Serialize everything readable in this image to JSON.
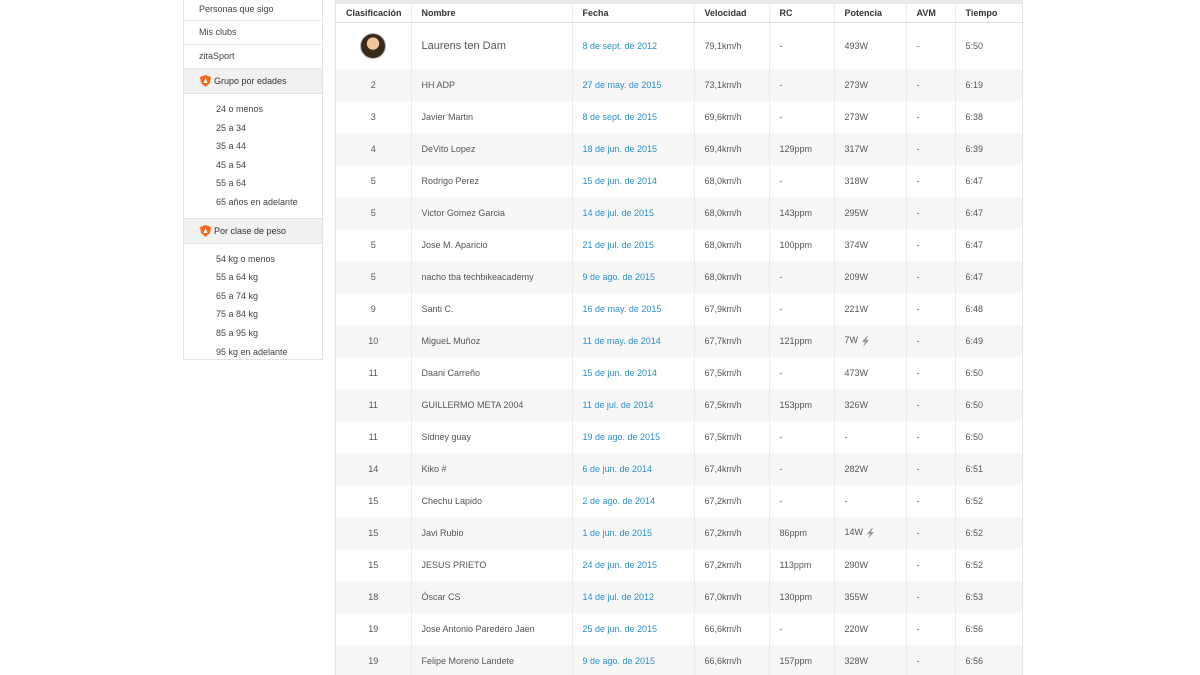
{
  "sidebar": {
    "links": [
      "Personas que sigo",
      "Mis clubs",
      "zitaSport"
    ],
    "age_group": {
      "title": "Grupo por edades",
      "items": [
        "24 o menos",
        "25 a 34",
        "35 a 44",
        "45 a 54",
        "55 a 64",
        "65 años en adelante"
      ]
    },
    "weight_group": {
      "title": "Por clase de peso",
      "items": [
        "54 kg o menos",
        "55 a 64 kg",
        "65 a 74 kg",
        "75 a 84 kg",
        "85 a 95 kg",
        "95 kg en adelante"
      ]
    }
  },
  "table": {
    "headers": [
      "Clasificación",
      "Nombre",
      "Fecha",
      "Velocidad",
      "RC",
      "Potencia",
      "AVM",
      "Tiempo"
    ],
    "first_row": {
      "name": "Laurens ten Dam",
      "date": "8 de sept. de 2012",
      "speed": "79,1km/h",
      "hr": "-",
      "power": "493W",
      "vam": "-",
      "time": "5:50"
    },
    "rows": [
      {
        "rank": "2",
        "name": "HH ADP",
        "date": "27 de may. de 2015",
        "speed": "73,1km/h",
        "hr": "-",
        "power": "273W",
        "vam": "-",
        "time": "6:19"
      },
      {
        "rank": "3",
        "name": "Javier Martin",
        "date": "8 de sept. de 2015",
        "speed": "69,6km/h",
        "hr": "-",
        "power": "273W",
        "vam": "-",
        "time": "6:38"
      },
      {
        "rank": "4",
        "name": "DeVito Lopez",
        "date": "18 de jun. de 2015",
        "speed": "69,4km/h",
        "hr": "129ppm",
        "power": "317W",
        "vam": "-",
        "time": "6:39"
      },
      {
        "rank": "5",
        "name": "Rodrigo Perez",
        "date": "15 de jun. de 2014",
        "speed": "68,0km/h",
        "hr": "-",
        "power": "318W",
        "vam": "-",
        "time": "6:47"
      },
      {
        "rank": "5",
        "name": "Victor Gomez Garcia",
        "date": "14 de jul. de 2015",
        "speed": "68,0km/h",
        "hr": "143ppm",
        "power": "295W",
        "vam": "-",
        "time": "6:47"
      },
      {
        "rank": "5",
        "name": "Jose M. Aparicio",
        "date": "21 de jul. de 2015",
        "speed": "68,0km/h",
        "hr": "100ppm",
        "power": "374W",
        "vam": "-",
        "time": "6:47"
      },
      {
        "rank": "5",
        "name": "nacho tba techbikeacademy",
        "date": "9 de ago. de 2015",
        "speed": "68,0km/h",
        "hr": "-",
        "power": "209W",
        "vam": "-",
        "time": "6:47"
      },
      {
        "rank": "9",
        "name": "Santi C.",
        "date": "16 de may. de 2015",
        "speed": "67,9km/h",
        "hr": "-",
        "power": "221W",
        "vam": "-",
        "time": "6:48"
      },
      {
        "rank": "10",
        "name": "MigueL Muñoz",
        "date": "11 de may. de 2014",
        "speed": "67,7km/h",
        "hr": "121ppm",
        "power": "7W",
        "vam": "-",
        "time": "6:49",
        "bolt": true
      },
      {
        "rank": "11",
        "name": "Daani Carreño",
        "date": "15 de jun. de 2014",
        "speed": "67,5km/h",
        "hr": "-",
        "power": "473W",
        "vam": "-",
        "time": "6:50"
      },
      {
        "rank": "11",
        "name": "GUILLERMO META 2004",
        "date": "11 de jul. de 2014",
        "speed": "67,5km/h",
        "hr": "153ppm",
        "power": "326W",
        "vam": "-",
        "time": "6:50"
      },
      {
        "rank": "11",
        "name": "Sidney guay",
        "date": "19 de ago. de 2015",
        "speed": "67,5km/h",
        "hr": "-",
        "power": "-",
        "vam": "-",
        "time": "6:50"
      },
      {
        "rank": "14",
        "name": "Kiko #",
        "date": "6 de jun. de 2014",
        "speed": "67,4km/h",
        "hr": "-",
        "power": "282W",
        "vam": "-",
        "time": "6:51"
      },
      {
        "rank": "15",
        "name": "Chechu Lapido",
        "date": "2 de ago. de 2014",
        "speed": "67,2km/h",
        "hr": "-",
        "power": "-",
        "vam": "-",
        "time": "6:52"
      },
      {
        "rank": "15",
        "name": "Javi Rubio",
        "date": "1 de jun. de 2015",
        "speed": "67,2km/h",
        "hr": "86ppm",
        "power": "14W",
        "vam": "-",
        "time": "6:52",
        "bolt": true
      },
      {
        "rank": "15",
        "name": "JESUS PRIETO",
        "date": "24 de jun. de 2015",
        "speed": "67,2km/h",
        "hr": "113ppm",
        "power": "290W",
        "vam": "-",
        "time": "6:52"
      },
      {
        "rank": "18",
        "name": "Óscar CS",
        "date": "14 de jul. de 2012",
        "speed": "67,0km/h",
        "hr": "130ppm",
        "power": "355W",
        "vam": "-",
        "time": "6:53"
      },
      {
        "rank": "19",
        "name": "Jose Antonio Paredero Jaen",
        "date": "25 de jun. de 2015",
        "speed": "66,6km/h",
        "hr": "-",
        "power": "220W",
        "vam": "-",
        "time": "6:56"
      },
      {
        "rank": "19",
        "name": "Felipe Moreno Landete",
        "date": "9 de ago. de 2015",
        "speed": "66,6km/h",
        "hr": "157ppm",
        "power": "328W",
        "vam": "-",
        "time": "6:56"
      }
    ]
  },
  "colors": {
    "link": "#2a8fc5",
    "badge": "#f26b21"
  }
}
